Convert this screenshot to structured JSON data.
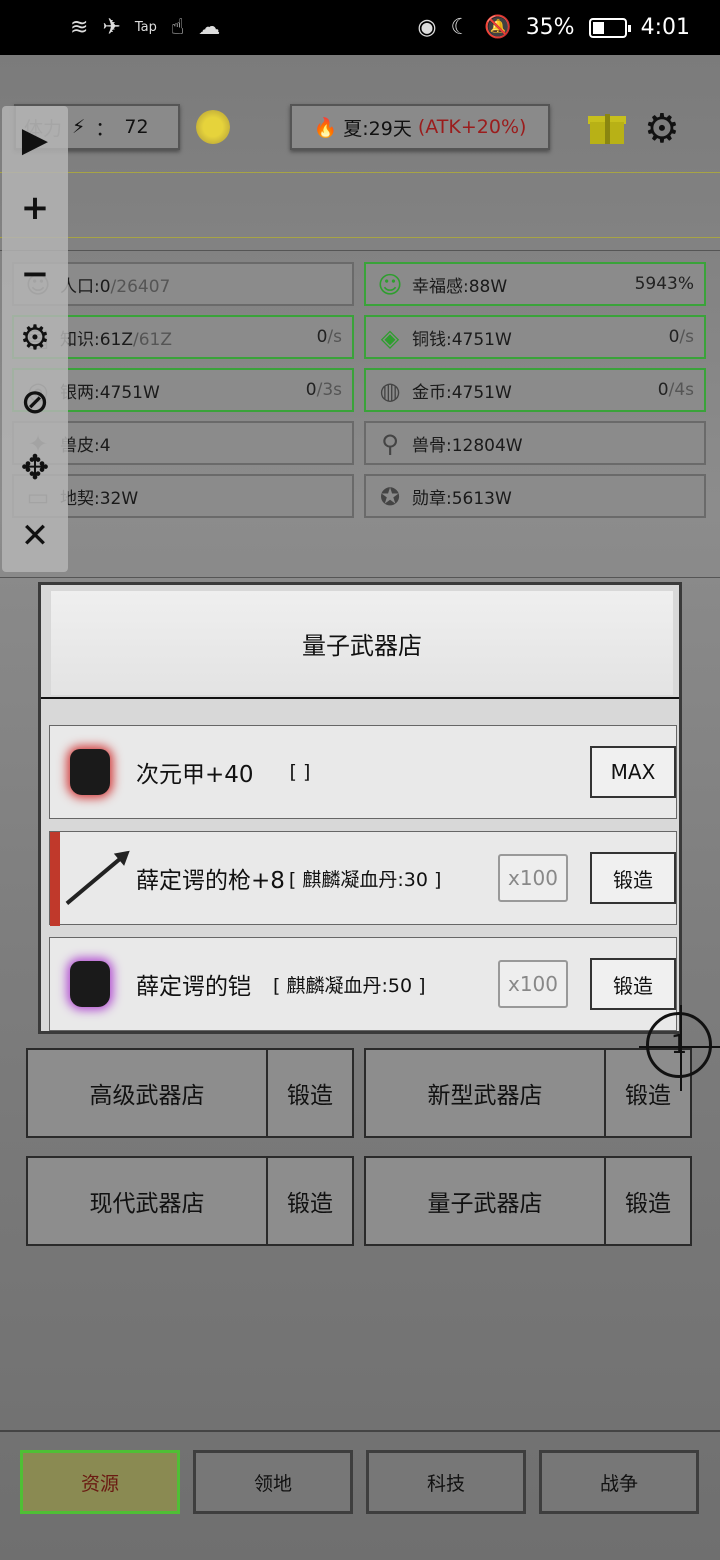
{
  "status_bar": {
    "left_icons": [
      "wifi-icon",
      "airplane-icon",
      "tap-icon",
      "touch-icon",
      "cloud-icon"
    ],
    "tap_label": "Tap",
    "right_icons": [
      "eye-icon",
      "moon-icon",
      "bell-off-icon",
      "battery-icon"
    ],
    "battery_text": "35%",
    "time": "4:01"
  },
  "top": {
    "stamina_label": "体力",
    "stamina_sep": "：",
    "stamina_value": "72",
    "season_text": "夏:29天",
    "season_bonus": "(ATK+20%)"
  },
  "resources": [
    {
      "icon": "person-icon",
      "label": "人口:0",
      "suffix": "/26407",
      "rate": "",
      "rate_suffix": "",
      "green": false
    },
    {
      "icon": "smile-icon",
      "label": "幸福感:88W",
      "suffix": "",
      "rate": "5943%",
      "rate_suffix": "",
      "green": true
    },
    {
      "icon": "book-icon",
      "label": "知识:61Z",
      "suffix": "/61Z",
      "rate": "0",
      "rate_suffix": "/s",
      "green": true
    },
    {
      "icon": "coin-icon",
      "label": "铜钱:4751W",
      "suffix": "",
      "rate": "0",
      "rate_suffix": "/s",
      "green": true
    },
    {
      "icon": "silver-icon",
      "label": "银两:4751W",
      "suffix": "",
      "rate": "0",
      "rate_suffix": "/3s",
      "green": true
    },
    {
      "icon": "gold-icon",
      "label": "金币:4751W",
      "suffix": "",
      "rate": "0",
      "rate_suffix": "/4s",
      "green": true
    },
    {
      "icon": "hide-icon",
      "label": "兽皮:4",
      "suffix": "",
      "rate": "",
      "rate_suffix": "",
      "green": false
    },
    {
      "icon": "bone-icon",
      "label": "兽骨:12804W",
      "suffix": "",
      "rate": "",
      "rate_suffix": "",
      "green": false
    },
    {
      "icon": "deed-icon",
      "label": "地契:32W",
      "suffix": "",
      "rate": "",
      "rate_suffix": "",
      "green": false
    },
    {
      "icon": "medal-icon",
      "label": "勋章:5613W",
      "suffix": "",
      "rate": "",
      "rate_suffix": "",
      "green": false
    }
  ],
  "floatbar": {
    "items": [
      "play-icon",
      "plus-icon",
      "minus-icon",
      "gear-icon",
      "eye-off-icon",
      "move-icon",
      "close-icon"
    ]
  },
  "modal": {
    "title": "量子武器店",
    "items": [
      {
        "name": "次元甲+40",
        "req": "[ ]",
        "qty": "",
        "button": "MAX"
      },
      {
        "name": "薛定谔的枪+8",
        "req": "[ 麒麟凝血丹:30 ]",
        "qty": "x100",
        "button": "锻造"
      },
      {
        "name": "薛定谔的铠",
        "req": "[ 麒麟凝血丹:50 ]",
        "qty": "x100",
        "button": "锻造"
      }
    ]
  },
  "shops": [
    {
      "name": "高级武器店",
      "forge": "锻造"
    },
    {
      "name": "新型武器店",
      "forge": "锻造"
    },
    {
      "name": "现代武器店",
      "forge": "锻造"
    },
    {
      "name": "量子武器店",
      "forge": "锻造"
    }
  ],
  "crosshair_label": "1",
  "nav": [
    "资源",
    "领地",
    "科技",
    "战争"
  ]
}
